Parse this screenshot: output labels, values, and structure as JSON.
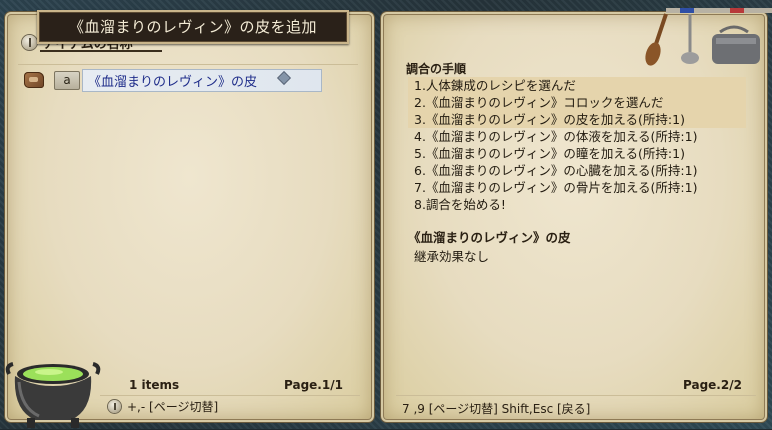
{
  "window": {
    "title": "《血溜まりのレヴィン》の皮を追加"
  },
  "item_list": {
    "header": "アイテムの名称",
    "items": [
      {
        "grade": "a",
        "name": "《血溜まりのレヴィン》の皮"
      }
    ],
    "count_text": "1 items",
    "page_text": "Page.1/1",
    "hint": "+,- [ページ切替]"
  },
  "recipe": {
    "steps_title": "調合の手順",
    "steps": [
      {
        "text": "1.人体錬成のレシピを選んだ",
        "done": true
      },
      {
        "text": "2.《血溜まりのレヴィン》コロックを選んだ",
        "done": true
      },
      {
        "text": "3.《血溜まりのレヴィン》の皮を加える(所持:1)",
        "done": true
      },
      {
        "text": "4.《血溜まりのレヴィン》の体液を加える(所持:1)",
        "done": false
      },
      {
        "text": "5.《血溜まりのレヴィン》の瞳を加える(所持:1)",
        "done": false
      },
      {
        "text": "6.《血溜まりのレヴィン》の心臓を加える(所持:1)",
        "done": false
      },
      {
        "text": "7.《血溜まりのレヴィン》の骨片を加える(所持:1)",
        "done": false
      },
      {
        "text": "8.調合を始める!",
        "done": false
      }
    ],
    "detail_title": "《血溜まりのレヴィン》の皮",
    "detail_text": "継承効果なし",
    "page_text": "Page.2/2",
    "hint": "7 ,9 [ページ切替]  Shift,Esc [戻る]"
  },
  "colors": {
    "parchment": "#e9dfc4",
    "title_bg": "#2a2119",
    "item_text": "#1f2d8a",
    "step_highlight": "#e5d4ac"
  },
  "icons": {
    "header_icon": "info-circle-icon",
    "item_icon": "leather-bag-icon",
    "cauldron": "cauldron-icon",
    "utensils": "cooking-utensils-icon"
  }
}
